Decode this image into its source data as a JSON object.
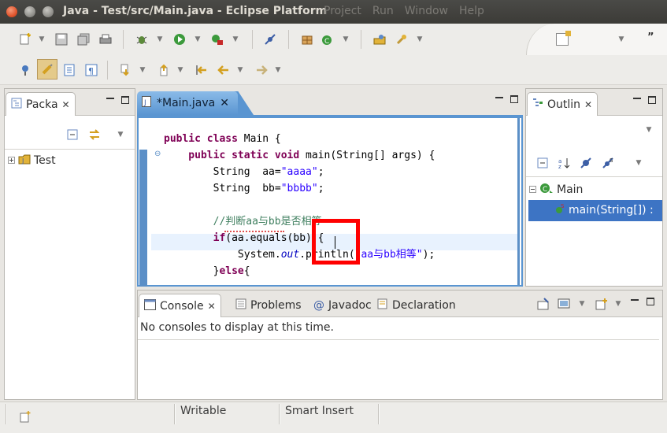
{
  "window": {
    "title": "Java - Test/src/Main.java - Eclipse Platform",
    "menu": [
      "Project",
      "Run",
      "Window",
      "Help"
    ]
  },
  "package_explorer": {
    "tab_label": "Packa",
    "tree": [
      {
        "label": "Test"
      }
    ]
  },
  "editor": {
    "tab_label": "*Main.java",
    "code_lines": [
      {
        "tokens": [
          {
            "t": "public ",
            "c": "kw"
          },
          {
            "t": "class ",
            "c": "kw"
          },
          {
            "t": "Main {",
            "c": ""
          }
        ]
      },
      {
        "tokens": [
          {
            "t": "    public ",
            "c": "kw"
          },
          {
            "t": "static ",
            "c": "kw"
          },
          {
            "t": "void ",
            "c": "kw"
          },
          {
            "t": "main(String[] args) {",
            "c": ""
          }
        ]
      },
      {
        "tokens": [
          {
            "t": "        String  aa=",
            "c": ""
          },
          {
            "t": "\"aaaa\"",
            "c": "str"
          },
          {
            "t": ";",
            "c": ""
          }
        ]
      },
      {
        "tokens": [
          {
            "t": "        String  bb=",
            "c": ""
          },
          {
            "t": "\"bbbb\"",
            "c": "str"
          },
          {
            "t": ";",
            "c": ""
          }
        ]
      },
      {
        "tokens": []
      },
      {
        "tokens": [
          {
            "t": "        //判断aa与bb是否相等",
            "c": "cmt"
          }
        ]
      },
      {
        "tokens": [
          {
            "t": "        if",
            "c": "kw"
          },
          {
            "t": "(aa.equals(bb)){",
            "c": ""
          }
        ]
      },
      {
        "tokens": [
          {
            "t": "            System.",
            "c": ""
          },
          {
            "t": "out",
            "c": "itl"
          },
          {
            "t": ".println(",
            "c": ""
          },
          {
            "t": "\"aa与bb相等\"",
            "c": "str"
          },
          {
            "t": ");",
            "c": ""
          }
        ]
      },
      {
        "tokens": [
          {
            "t": "        }",
            "c": ""
          },
          {
            "t": "else",
            "c": "kw"
          },
          {
            "t": "{",
            "c": ""
          }
        ]
      }
    ]
  },
  "outline": {
    "tab_label": "Outlin",
    "class_name": "Main",
    "method": "main(String[]) : "
  },
  "bottom_panel": {
    "tabs": [
      {
        "label": "Console"
      },
      {
        "label": "Problems"
      },
      {
        "label": "Javadoc"
      },
      {
        "label": "Declaration"
      }
    ],
    "message": "No consoles to display at this time."
  },
  "status_bar": {
    "writable": "Writable",
    "insert_mode": "Smart Insert"
  },
  "colors": {
    "editor_accent": "#5a95d1",
    "selection": "#3d74c4",
    "keyword": "#7f0055",
    "string": "#2a00ff",
    "comment": "#3f7f5f",
    "highlight_box": "#ff0000"
  },
  "icons": {
    "toolbar1": [
      "new-icon",
      "save-icon",
      "save-all-icon",
      "print-icon",
      "debug-icon",
      "run-icon",
      "external-tools-icon",
      "skip-breakpoints-icon",
      "new-java-package-icon",
      "new-class-icon"
    ],
    "toolbar2": [
      "toggle-breadcrumb-icon",
      "mark-occurrences-icon",
      "block-selection-icon",
      "show-whitespace-icon",
      "next-annotation-icon",
      "previous-annotation-icon",
      "last-edit-icon",
      "back-icon",
      "forward-icon"
    ]
  }
}
